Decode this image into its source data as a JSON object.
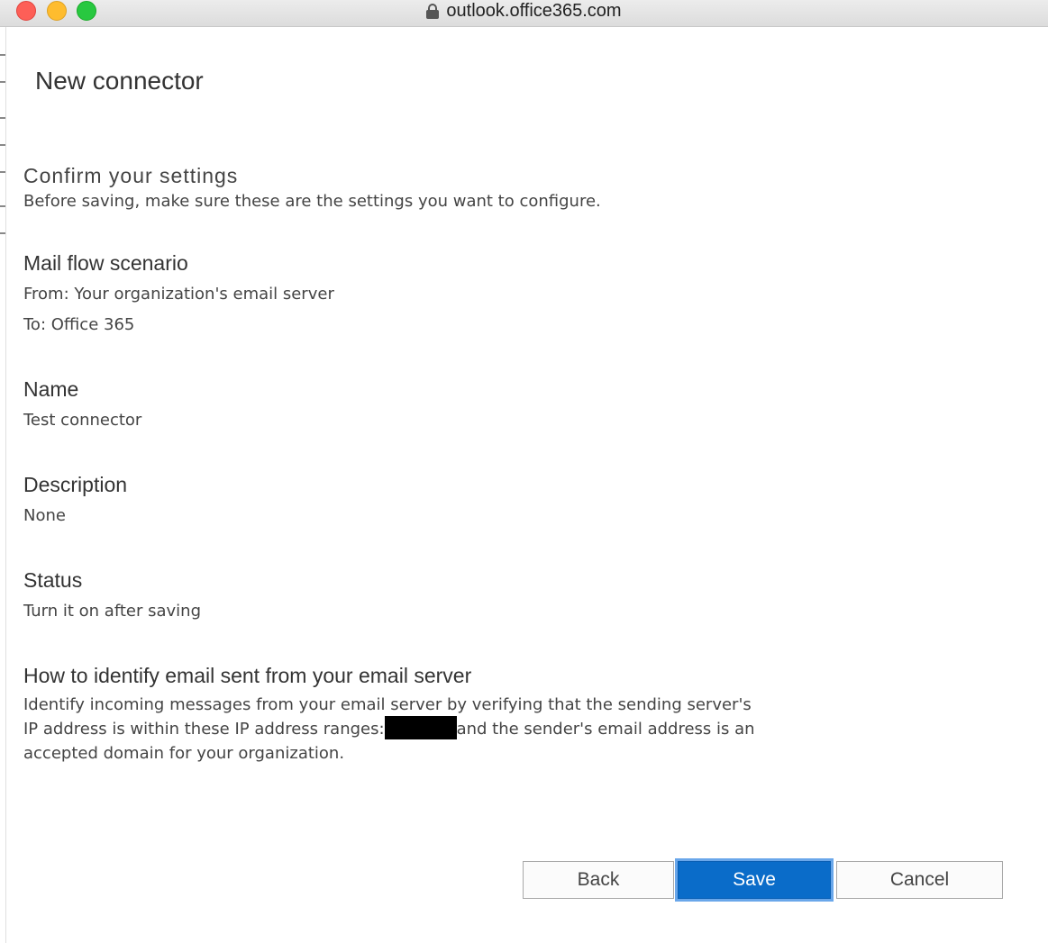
{
  "browser": {
    "url": "outlook.office365.com"
  },
  "page": {
    "title": "New connector"
  },
  "confirm": {
    "heading": "Confirm your settings",
    "description": "Before saving, make sure these are the settings you want to configure."
  },
  "mail_flow": {
    "heading": "Mail flow scenario",
    "from": "From: Your organization's email server",
    "to": "To: Office 365"
  },
  "name": {
    "heading": "Name",
    "value": "Test connector"
  },
  "description": {
    "heading": "Description",
    "value": "None"
  },
  "status": {
    "heading": "Status",
    "value": "Turn it on after saving"
  },
  "identify": {
    "heading": "How to identify email sent from your email server",
    "line1": "Identify incoming messages from your email server by verifying that the sending server's",
    "line2_before": "IP address is within these IP address ranges:",
    "line2_after": "and the sender's email address is an",
    "line3": "accepted domain for your organization."
  },
  "buttons": {
    "back": "Back",
    "save": "Save",
    "cancel": "Cancel"
  },
  "colors": {
    "primary": "#0a6cc9",
    "focus_ring": "#6aa7ea"
  }
}
